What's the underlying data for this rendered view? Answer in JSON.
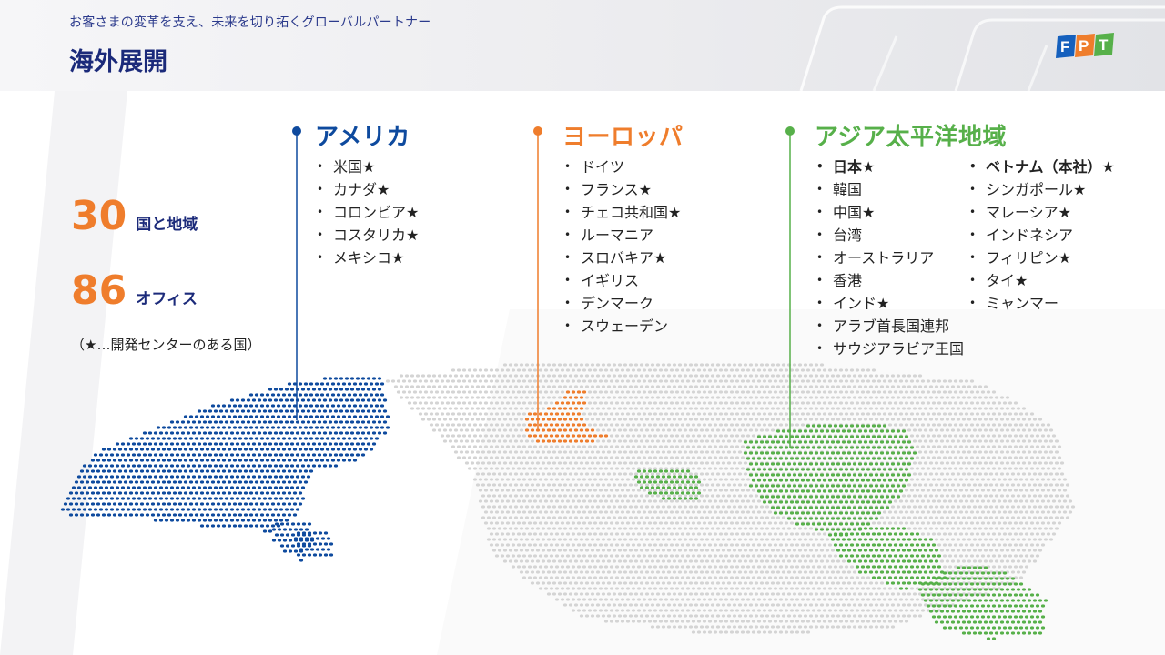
{
  "header": {
    "subtitle": "お客さまの変革を支え、未来を切り拓くグローバルパートナー",
    "title": "海外展開",
    "logo_text": "FPT"
  },
  "stats": [
    {
      "number": "30",
      "label": "国と地域"
    },
    {
      "number": "86",
      "label": "オフィス"
    }
  ],
  "legend_note": "（★…開発センターのある国）",
  "colors": {
    "america": "#0e4a9e",
    "europe": "#ef7d2c",
    "asia": "#57b04a",
    "title": "#1b2a7a",
    "map_gray": "#d4d4d4"
  },
  "regions": {
    "america": {
      "title": "アメリカ",
      "items": [
        "米国★",
        "カナダ★",
        "コロンビア★",
        "コスタリカ★",
        "メキシコ★"
      ]
    },
    "europe": {
      "title": "ヨーロッパ",
      "items": [
        "ドイツ",
        "フランス★",
        "チェコ共和国★",
        "ルーマニア",
        "スロバキア★",
        "イギリス",
        "デンマーク",
        "スウェーデン"
      ]
    },
    "asia": {
      "title": "アジア太平洋地域",
      "col1": [
        "日本★",
        "韓国",
        "中国★",
        "台湾",
        "オーストラリア",
        "香港",
        "インド★",
        "アラブ首長国連邦",
        "サウジアラビア王国"
      ],
      "col2": [
        "ベトナム（本社）★",
        "シンガポール★",
        "マレーシア★",
        "インドネシア",
        "フィリピン★",
        "タイ★",
        "ミャンマー"
      ]
    }
  }
}
